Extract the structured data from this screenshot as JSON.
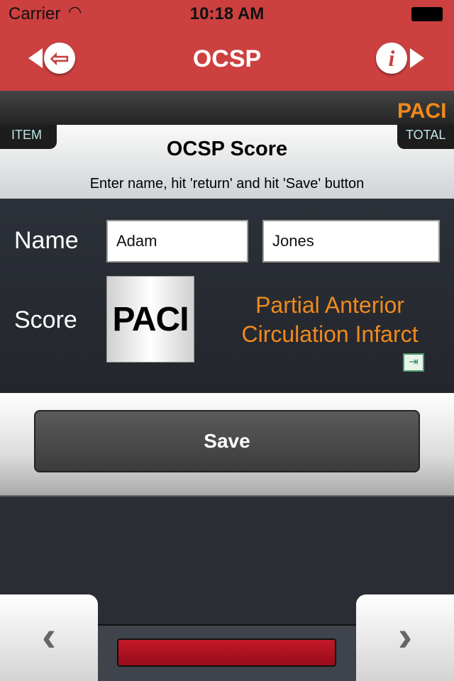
{
  "status": {
    "carrier": "Carrier",
    "time": "10:18 AM"
  },
  "nav": {
    "title": "OCSP",
    "back_icon": "back-arrow-icon",
    "info_icon": "info-icon"
  },
  "header": {
    "item_label": "ITEM",
    "total_label": "TOTAL",
    "total_value": "PACI",
    "title": "OCSP Score",
    "instruction": "Enter name, hit 'return' and hit 'Save' button"
  },
  "form": {
    "name_label": "Name",
    "first_name": "Adam",
    "last_name": "Jones",
    "score_label": "Score",
    "score_value": "PACI",
    "score_line1": "Partial Anterior",
    "score_line2": "Circulation Infarct"
  },
  "save_label": "Save",
  "colors": {
    "nav": "#cc4040",
    "accent": "#f08a1c",
    "progress": "#b01424"
  }
}
